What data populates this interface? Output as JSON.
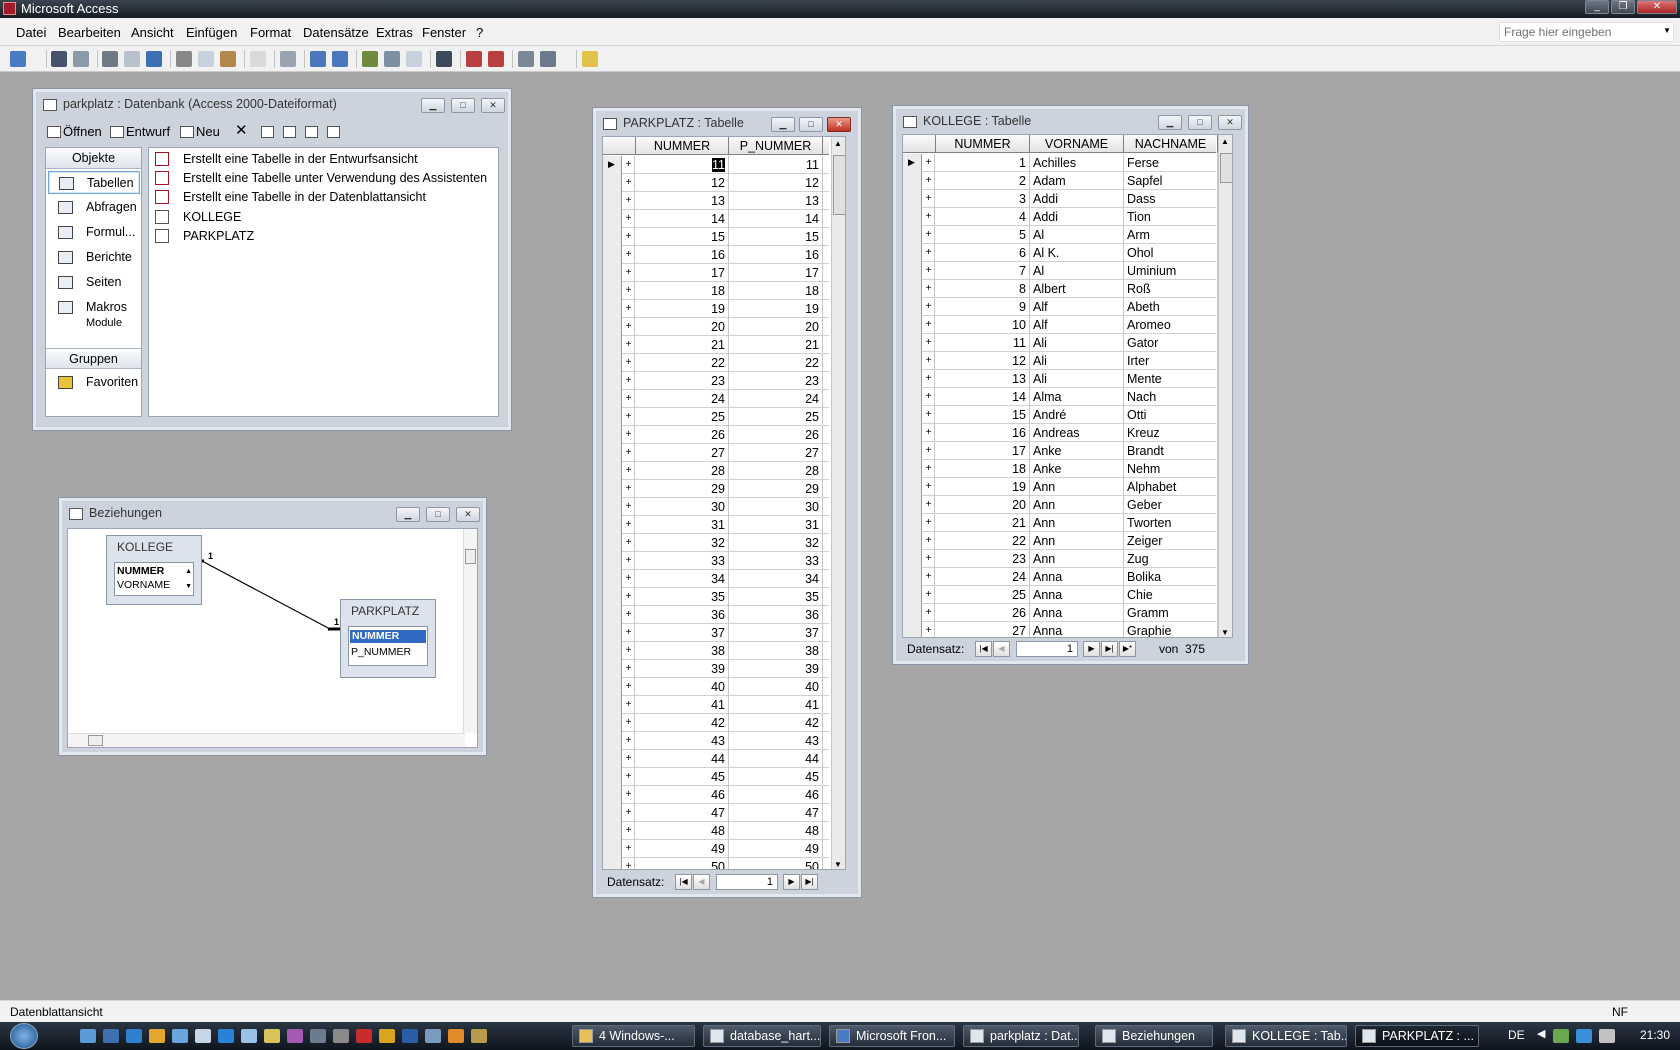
{
  "app": {
    "title": "Microsoft Access"
  },
  "menu": [
    "Datei",
    "Bearbeiten",
    "Ansicht",
    "Einfügen",
    "Format",
    "Datensätze",
    "Extras",
    "Fenster",
    "?"
  ],
  "help_placeholder": "Frage hier eingeben",
  "db_window": {
    "title": "parkplatz : Datenbank (Access 2000-Dateiformat)",
    "toolbar": {
      "open": "Öffnen",
      "design": "Entwurf",
      "new": "Neu"
    },
    "objects_header": "Objekte",
    "objects": [
      "Tabellen",
      "Abfragen",
      "Formul...",
      "Berichte",
      "Seiten",
      "Makros",
      "Module"
    ],
    "groups_header": "Gruppen",
    "favorites": "Favoriten",
    "list": [
      {
        "label": "Erstellt eine Tabelle in der Entwurfsansicht",
        "icon": "wizard-icon"
      },
      {
        "label": "Erstellt eine Tabelle unter Verwendung des Assistenten",
        "icon": "wizard-icon"
      },
      {
        "label": "Erstellt eine Tabelle in der Datenblattansicht",
        "icon": "wizard-icon"
      },
      {
        "label": "KOLLEGE",
        "icon": "table-icon"
      },
      {
        "label": "PARKPLATZ",
        "icon": "table-icon"
      }
    ]
  },
  "relations_window": {
    "title": "Beziehungen",
    "kollege": {
      "name": "KOLLEGE",
      "fields": [
        "NUMMER",
        "VORNAME"
      ]
    },
    "parkplatz": {
      "name": "PARKPLATZ",
      "fields": [
        "NUMMER",
        "P_NUMMER"
      ]
    },
    "cardinality_left": "1",
    "cardinality_right": "1"
  },
  "parkplatz_table": {
    "title": "PARKPLATZ : Tabelle",
    "columns": [
      "NUMMER",
      "P_NUMMER"
    ],
    "rows": [
      [
        11,
        11
      ],
      [
        12,
        12
      ],
      [
        13,
        13
      ],
      [
        14,
        14
      ],
      [
        15,
        15
      ],
      [
        16,
        16
      ],
      [
        17,
        17
      ],
      [
        18,
        18
      ],
      [
        19,
        19
      ],
      [
        20,
        20
      ],
      [
        21,
        21
      ],
      [
        22,
        22
      ],
      [
        23,
        23
      ],
      [
        24,
        24
      ],
      [
        25,
        25
      ],
      [
        26,
        26
      ],
      [
        27,
        27
      ],
      [
        28,
        28
      ],
      [
        29,
        29
      ],
      [
        30,
        30
      ],
      [
        31,
        31
      ],
      [
        32,
        32
      ],
      [
        33,
        33
      ],
      [
        34,
        34
      ],
      [
        35,
        35
      ],
      [
        36,
        36
      ],
      [
        37,
        37
      ],
      [
        38,
        38
      ],
      [
        39,
        39
      ],
      [
        40,
        40
      ],
      [
        41,
        41
      ],
      [
        42,
        42
      ],
      [
        43,
        43
      ],
      [
        44,
        44
      ],
      [
        45,
        45
      ],
      [
        46,
        46
      ],
      [
        47,
        47
      ],
      [
        48,
        48
      ],
      [
        49,
        49
      ],
      [
        50,
        50
      ]
    ],
    "nav_label": "Datensatz:",
    "record": "1"
  },
  "kollege_table": {
    "title": "KOLLEGE : Tabelle",
    "columns": [
      "NUMMER",
      "VORNAME",
      "NACHNAME"
    ],
    "rows": [
      [
        1,
        "Achilles",
        "Ferse"
      ],
      [
        2,
        "Adam",
        "Sapfel"
      ],
      [
        3,
        "Addi",
        "Dass"
      ],
      [
        4,
        "Addi",
        "Tion"
      ],
      [
        5,
        "Al",
        "Arm"
      ],
      [
        6,
        "Al K.",
        "Ohol"
      ],
      [
        7,
        "Al",
        "Uminium"
      ],
      [
        8,
        "Albert",
        "Roß"
      ],
      [
        9,
        "Alf",
        "Abeth"
      ],
      [
        10,
        "Alf",
        "Aromeo"
      ],
      [
        11,
        "Ali",
        "Gator"
      ],
      [
        12,
        "Ali",
        "Irter"
      ],
      [
        13,
        "Ali",
        "Mente"
      ],
      [
        14,
        "Alma",
        "Nach"
      ],
      [
        15,
        "André",
        "Otti"
      ],
      [
        16,
        "Andreas",
        "Kreuz"
      ],
      [
        17,
        "Anke",
        "Brandt"
      ],
      [
        18,
        "Anke",
        "Nehm"
      ],
      [
        19,
        "Ann",
        "Alphabet"
      ],
      [
        20,
        "Ann",
        "Geber"
      ],
      [
        21,
        "Ann",
        "Tworten"
      ],
      [
        22,
        "Ann",
        "Zeiger"
      ],
      [
        23,
        "Ann",
        "Zug"
      ],
      [
        24,
        "Anna",
        "Bolika"
      ],
      [
        25,
        "Anna",
        "Chie"
      ],
      [
        26,
        "Anna",
        "Gramm"
      ],
      [
        27,
        "Anna",
        "Graphie"
      ]
    ],
    "nav_label": "Datensatz:",
    "record": "1",
    "of_label": "von",
    "total": "375"
  },
  "status": {
    "text": "Datenblattansicht",
    "right": "NF"
  },
  "taskbar": {
    "tasks": [
      "4 Windows-...",
      "database_hart...",
      "Microsoft Fron...",
      "parkplatz : Dat...",
      "Beziehungen",
      "KOLLEGE : Tab...",
      "PARKPLATZ : ..."
    ],
    "lang": "DE",
    "clock": "21:30"
  },
  "colors": {
    "selection": "#316ac5",
    "title_dark": "#161c22",
    "desktop": "#a6a6a6"
  }
}
